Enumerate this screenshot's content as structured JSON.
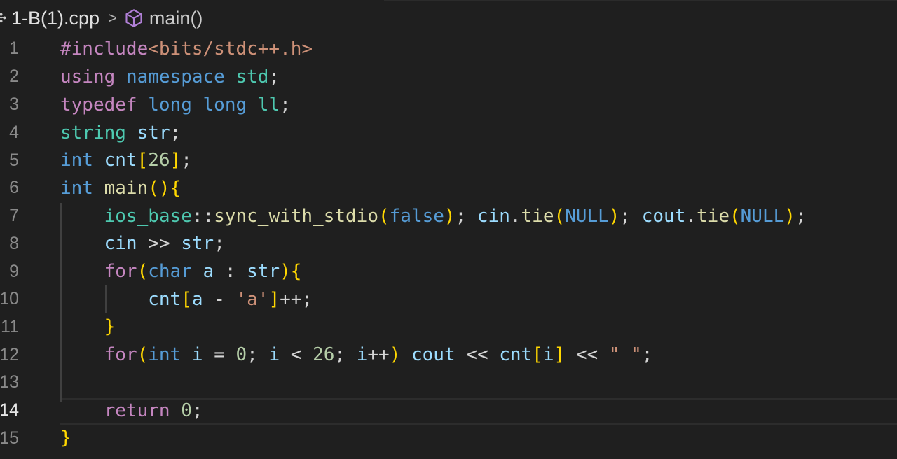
{
  "breadcrumb": {
    "file": "1-B(1).cpp",
    "separator": ">",
    "symbol": "main()",
    "icons": [
      "file-icon",
      "chevron-right-icon",
      "cube-icon"
    ]
  },
  "editor": {
    "active_line": 14,
    "line_numbers": [
      "1",
      "2",
      "3",
      "4",
      "5",
      "6",
      "7",
      "8",
      "9",
      "10",
      "11",
      "12",
      "13",
      "14",
      "15"
    ],
    "lines": [
      "#include<bits/stdc++.h>",
      "using namespace std;",
      "typedef long long ll;",
      "string str;",
      "int cnt[26];",
      "int main(){",
      "    ios_base::sync_with_stdio(false); cin.tie(NULL); cout.tie(NULL);",
      "    cin >> str;",
      "    for(char a : str){",
      "        cnt[a - 'a']++;",
      "    }",
      "    for(int i = 0; i < 26; i++) cout << cnt[i] << \" \";",
      "",
      "    return 0;",
      "}"
    ]
  },
  "colors": {
    "background": "#1f1f1f",
    "keyword": "#c586c0",
    "type": "#569cd6",
    "namespace": "#4ec9b0",
    "function": "#dcdcaa",
    "variable": "#9cdcfe",
    "string": "#ce9178",
    "number": "#b5cea8",
    "bracket_gold": "#ffd700"
  }
}
